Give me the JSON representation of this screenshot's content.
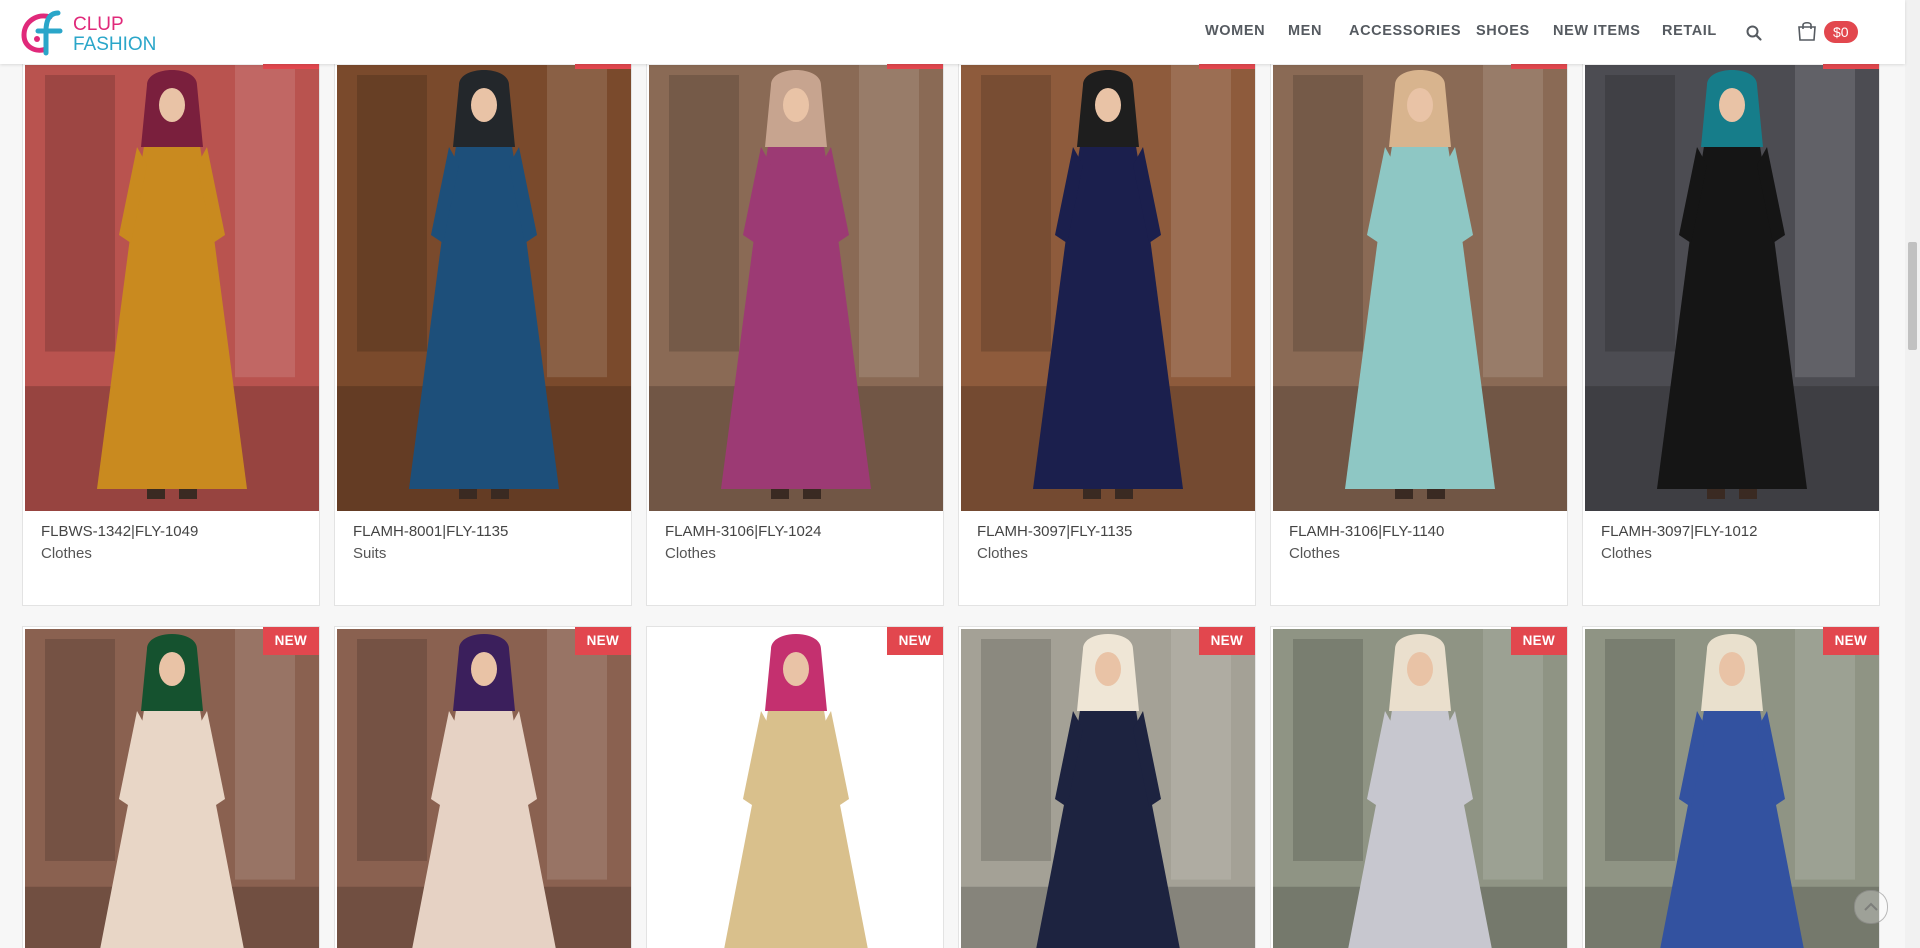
{
  "brand": {
    "line1": "CLUP",
    "line2": "FASHION",
    "pink": "#e0297a",
    "teal": "#2aa6c9"
  },
  "nav": {
    "items": [
      "WOMEN",
      "MEN",
      "ACCESSORIES",
      "SHOES",
      "NEW ITEMS",
      "RETAIL"
    ],
    "search_icon": "search-icon",
    "cart_label": "$0",
    "cart_icon": "shopping-bag-icon"
  },
  "colors": {
    "badge": "#e2474e",
    "nav_text": "#555a60"
  },
  "products_row1": [
    {
      "sku": "FLBWS-1342|FLY-1049",
      "category": "Clothes",
      "badge": "NEW",
      "scarf": "#7a1f3d",
      "dress": "#c98a1f",
      "bg": "#b9534f"
    },
    {
      "sku": "FLAMH-8001|FLY-1135",
      "category": "Suits",
      "badge": "NEW",
      "scarf": "#23272b",
      "dress": "#1d4f7a",
      "bg": "#7a4a2c"
    },
    {
      "sku": "FLAMH-3106|FLY-1024",
      "category": "Clothes",
      "badge": "NEW",
      "scarf": "#c7a48f",
      "dress": "#9c3a74",
      "bg": "#8a6a55"
    },
    {
      "sku": "FLAMH-3097|FLY-1135",
      "category": "Clothes",
      "badge": "NEW",
      "scarf": "#1e1e1e",
      "dress": "#1b1f4d",
      "bg": "#8e5b3c"
    },
    {
      "sku": "FLAMH-3106|FLY-1140",
      "category": "Clothes",
      "badge": "NEW",
      "scarf": "#d8b48e",
      "dress": "#8ec7c4",
      "bg": "#8a6a55"
    },
    {
      "sku": "FLAMH-3097|FLY-1012",
      "category": "Clothes",
      "badge": "NEW",
      "scarf": "#167d8a",
      "dress": "#151515",
      "bg": "#4c4c52"
    }
  ],
  "products_row2": [
    {
      "badge": "NEW",
      "scarf": "#15522f",
      "dress": "#e8d6c6",
      "bg": "#8a6150"
    },
    {
      "badge": "NEW",
      "scarf": "#3b1f5c",
      "dress": "#e6d2c4",
      "bg": "#8a6150"
    },
    {
      "badge": "NEW",
      "scarf": "#c4306f",
      "dress": "#d9c08c",
      "bg": "#ffffff"
    },
    {
      "badge": "NEW",
      "scarf": "#efe6d6",
      "dress": "#1d2340",
      "bg": "#a4a196"
    },
    {
      "badge": "NEW",
      "scarf": "#eadfcd",
      "dress": "#c7c7cf",
      "bg": "#8f9484"
    },
    {
      "badge": "NEW",
      "scarf": "#e9e0cd",
      "dress": "#3352a0",
      "bg": "#8f9484"
    }
  ]
}
